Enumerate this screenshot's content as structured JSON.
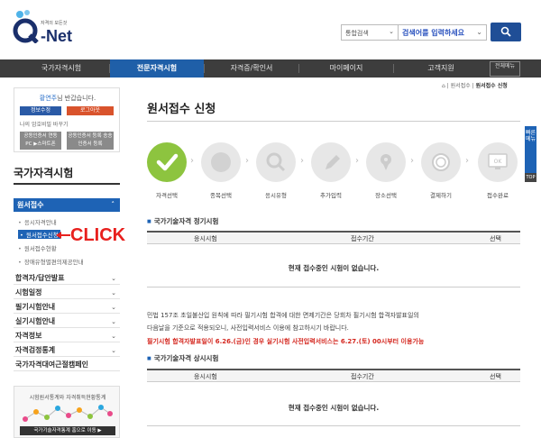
{
  "header": {
    "logo_slogan": "자격의 모든것",
    "logo_brand": "-Net",
    "search_type": "통합검색",
    "search_placeholder": "검색어를 입력하세요"
  },
  "gnb": {
    "items": [
      "국가자격시험",
      "전문자격시험",
      "자격증/확인서",
      "마이페이지",
      "고객지원"
    ],
    "all_menu": "전체메뉴",
    "active_index": 1
  },
  "login": {
    "greeting_name": "황연주",
    "greeting_rest": "님 반갑습니다.",
    "my_info": "정보수정",
    "logout": "로그아웃",
    "pw_change": "나의 암호비밀 바꾸기",
    "cert_left": "공동인증서 연동 PC ▶스마트폰",
    "cert_right": "공동인증서 등록 송송인증서 등록"
  },
  "sidebar": {
    "title": "국가자격시험",
    "active_menu": "원서접수",
    "sub_items": [
      "응시자격안내",
      "원서접수신청",
      "원서접수현황",
      "장애유형별편의제공안내"
    ],
    "selected_sub": 1,
    "menus": [
      "합격자/답안발표",
      "시험일정",
      "필기시험안내",
      "실기시험안내",
      "자격정보",
      "자격검정통계",
      "국가자격대여근절캠페인"
    ],
    "click_label": "CLICK",
    "stats_title": "시험원서통계와 자격취득현황통계",
    "stats_button": "국가기술자격통계 홈으로 이동 ▶"
  },
  "breadcrumb": {
    "home": "⌂",
    "level1": "원서접수",
    "current": "원서접수 신청"
  },
  "main": {
    "title": "원서접수 신청",
    "steps": [
      "자격선택",
      "종목선택",
      "응시유형",
      "추가입력",
      "장소선택",
      "결제하기",
      "접수완료"
    ],
    "section1_title": "국가기술자격 정기시험",
    "section2_title": "국가기술자격 상시시험",
    "col_exam": "응시시험",
    "col_period": "접수기간",
    "col_select": "선택",
    "empty_message": "현재 접수중인 시험이 없습니다.",
    "notice1": "민법 157조 초일불산입 원칙에 따라 필기시험 합격에 대한 면제기간은 당회차 필기시험 합격자발표일의",
    "notice2": "다음날을 기준으로 적용되오니, 사전입력서비스 이용에 참고하시기 바랍니다.",
    "notice_red": "필기시험 합격자발표일이 6.26.(금)인 경우 실기시험 사전입력서비스는 6.27.(토) 00시부터 이용가능"
  },
  "quick": {
    "label": "빠른메뉴",
    "top": "TOP"
  },
  "colors": {
    "brand_navy": "#1a2f6b",
    "primary_blue": "#1e63b5",
    "step_done": "#8dc43f",
    "alert_red": "#d4261e"
  }
}
